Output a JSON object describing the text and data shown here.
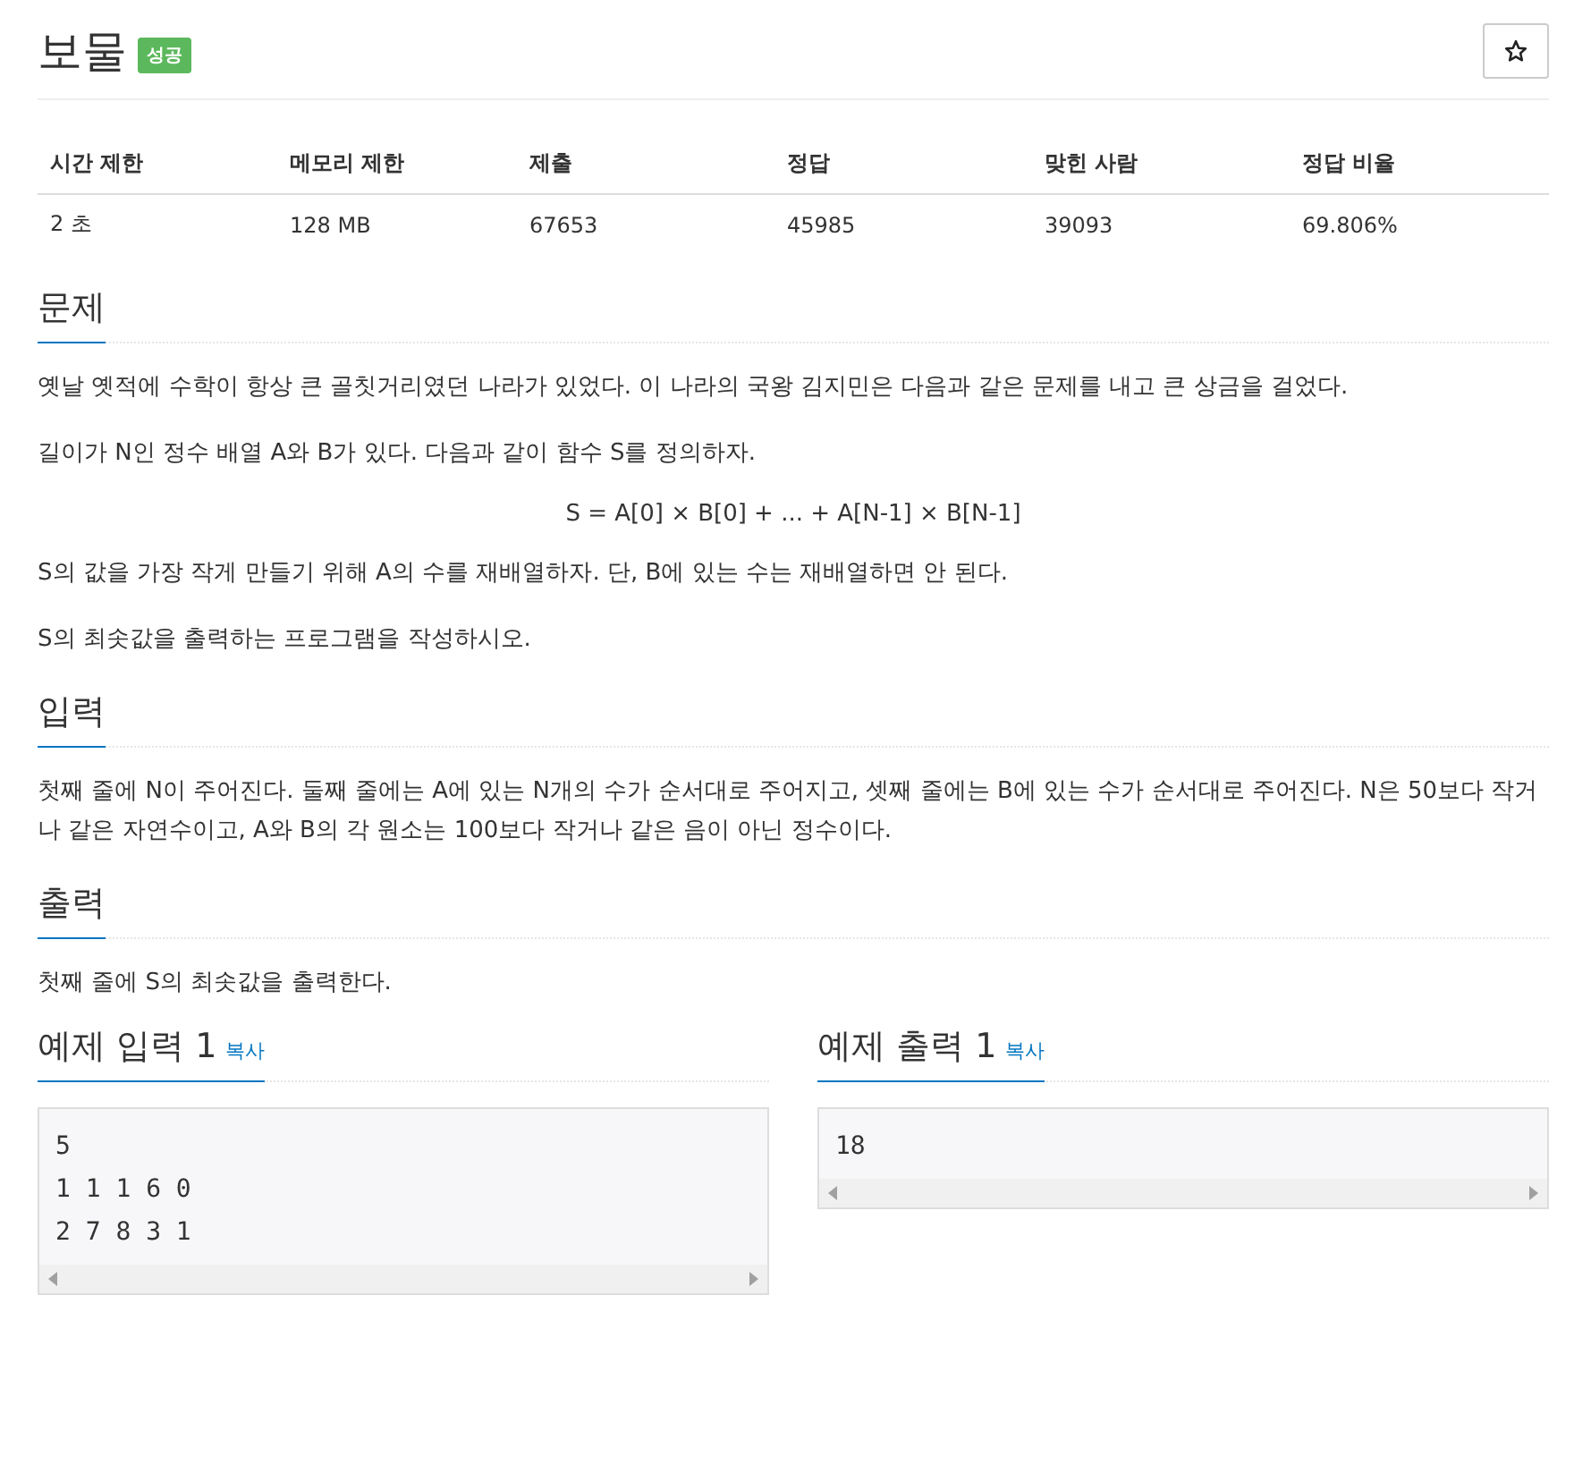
{
  "title": "보물",
  "badge": "성공",
  "stats": {
    "columns": [
      "시간 제한",
      "메모리 제한",
      "제출",
      "정답",
      "맞힌 사람",
      "정답 비율"
    ],
    "values": [
      "2 초",
      "128 MB",
      "67653",
      "45985",
      "39093",
      "69.806%"
    ]
  },
  "sections": [
    {
      "heading": "문제",
      "paragraphs": [
        {
          "kind": "text",
          "text": "옛날 옛적에 수학이 항상 큰 골칫거리였던 나라가 있었다. 이 나라의 국왕 김지민은 다음과 같은 문제를 내고 큰 상금을 걸었다."
        },
        {
          "kind": "text",
          "text": "길이가 N인 정수 배열 A와 B가 있다. 다음과 같이 함수 S를 정의하자."
        },
        {
          "kind": "formula",
          "text": "S = A[0] × B[0] + ... + A[N-1] × B[N-1]"
        },
        {
          "kind": "text",
          "text": "S의 값을 가장 작게 만들기 위해 A의 수를 재배열하자. 단, B에 있는 수는 재배열하면 안 된다."
        },
        {
          "kind": "text",
          "text": "S의 최솟값을 출력하는 프로그램을 작성하시오."
        }
      ]
    },
    {
      "heading": "입력",
      "paragraphs": [
        {
          "kind": "text",
          "text": "첫째 줄에 N이 주어진다. 둘째 줄에는 A에 있는 N개의 수가 순서대로 주어지고, 셋째 줄에는 B에 있는 수가 순서대로 주어진다. N은 50보다 작거나 같은 자연수이고, A와 B의 각 원소는 100보다 작거나 같은 음이 아닌 정수이다."
        }
      ]
    },
    {
      "heading": "출력",
      "paragraphs": [
        {
          "kind": "text",
          "text": "첫째 줄에 S의 최솟값을 출력한다."
        }
      ]
    }
  ],
  "samples": [
    {
      "heading": "예제 입력 1",
      "copy": "복사",
      "lines": [
        "5",
        "1 1 1 6 0",
        "2 7 8 3 1"
      ]
    },
    {
      "heading": "예제 출력 1",
      "copy": "복사",
      "lines": [
        "18"
      ]
    }
  ]
}
